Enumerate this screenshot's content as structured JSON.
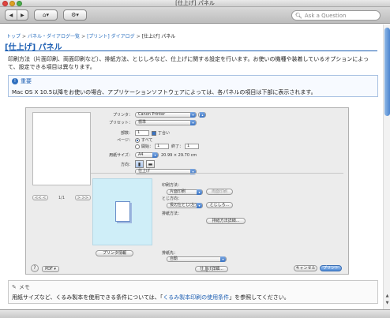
{
  "window": {
    "title": "[仕上げ] パネル"
  },
  "toolbar": {
    "back_icon": "◀",
    "forward_icon": "▶",
    "home_icon": "⌂",
    "gear_icon": "⚙",
    "dropdown_icon": "▾",
    "search_placeholder": "Ask a Question"
  },
  "breadcrumb": {
    "items": [
      "トップ",
      "パネル・ダイアログ一覧",
      "[プリント] ダイアログ",
      "[仕上げ] パネル"
    ],
    "separator": ">"
  },
  "page": {
    "title": "[仕上げ] パネル",
    "intro": "印刷方法（片面印刷、両面印刷など）、排紙方法、とじしろなど、仕上げに関する設定を行います。お使いの機種や装着しているオプションによって、設定できる項目は異なります。"
  },
  "notice": {
    "title": "重要",
    "icon": "!",
    "text": "Mac OS X 10.5以降をお使いの場合、アプリケーションソフトウェアによっては、各パネルの項目は下部に表示されます。"
  },
  "dialog": {
    "printer_label": "プリンタ：",
    "printer_value": "Canon Printer",
    "preset_label": "プリセット：",
    "preset_value": "標準",
    "copies_label": "部数：",
    "copies_value": "1",
    "collate_label": "丁合い",
    "pages_label": "ページ：",
    "pages_all": "すべて",
    "pages_from": "開始：",
    "pages_from_value": "1",
    "pages_to": "終了：",
    "pages_to_value": "1",
    "paper_label": "用紙サイズ：",
    "paper_value": "A4",
    "paper_dims": "20.99 × 29.70 cm",
    "orientation_label": "方向：",
    "panel_popup": "仕上げ",
    "print_method_label": "印刷方法：",
    "print_method_value": "片面印刷",
    "print_method_extra": "両面印刷",
    "binding_label": "とじ方向：",
    "binding_value": "長辺左とじ(左)",
    "binding_btn": "とじしろ...",
    "paper_output_label": "排紙方法：",
    "paper_output_btn": "排紙方法詳細...",
    "output_label": "排紙先：",
    "output_value": "自動",
    "finish_detail_btn": "仕上げ詳細...",
    "pager_prev": "<<   <",
    "pager_text": "1/1",
    "pager_next": ">   >>",
    "printer_info_btn": "プリンタ情報",
    "help": "?",
    "pdf": "PDF ▾",
    "cancel": "キャンセル",
    "print": "プリント"
  },
  "memo": {
    "title": "メモ",
    "text_before": "用紙サイズなど、くるみ製本を使用できる条件については、「",
    "link": "くるみ製本印刷の使用条件",
    "text_after": "」を参照してください。"
  }
}
